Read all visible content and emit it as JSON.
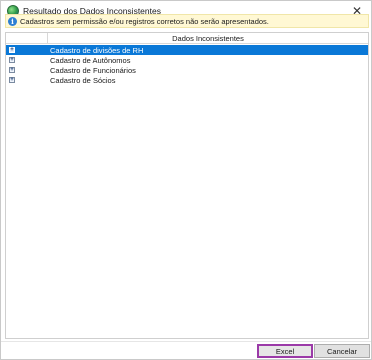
{
  "window": {
    "title": "Resultado dos Dados Inconsistentes",
    "close_glyph": "✕"
  },
  "info": {
    "icon": "info-icon",
    "message": "Cadastros sem permissão e/ou registros corretos não serão apresentados."
  },
  "grid": {
    "column_header": "Dados Inconsistentes",
    "rows": [
      {
        "label": "Cadastro de divisões de RH",
        "selected": true,
        "expand_glyph": "+"
      },
      {
        "label": "Cadastro de Autônomos",
        "selected": false,
        "expand_glyph": "+"
      },
      {
        "label": "Cadastro de Funcionários",
        "selected": false,
        "expand_glyph": "+"
      },
      {
        "label": "Cadastro de Sócios",
        "selected": false,
        "expand_glyph": "+"
      }
    ]
  },
  "buttons": {
    "excel_label": "Excel",
    "cancel_label": "Cancelar"
  },
  "colors": {
    "selection": "#0a78d7",
    "info_background": "#fff8d4",
    "excel_highlight": "#9b3aa8"
  }
}
